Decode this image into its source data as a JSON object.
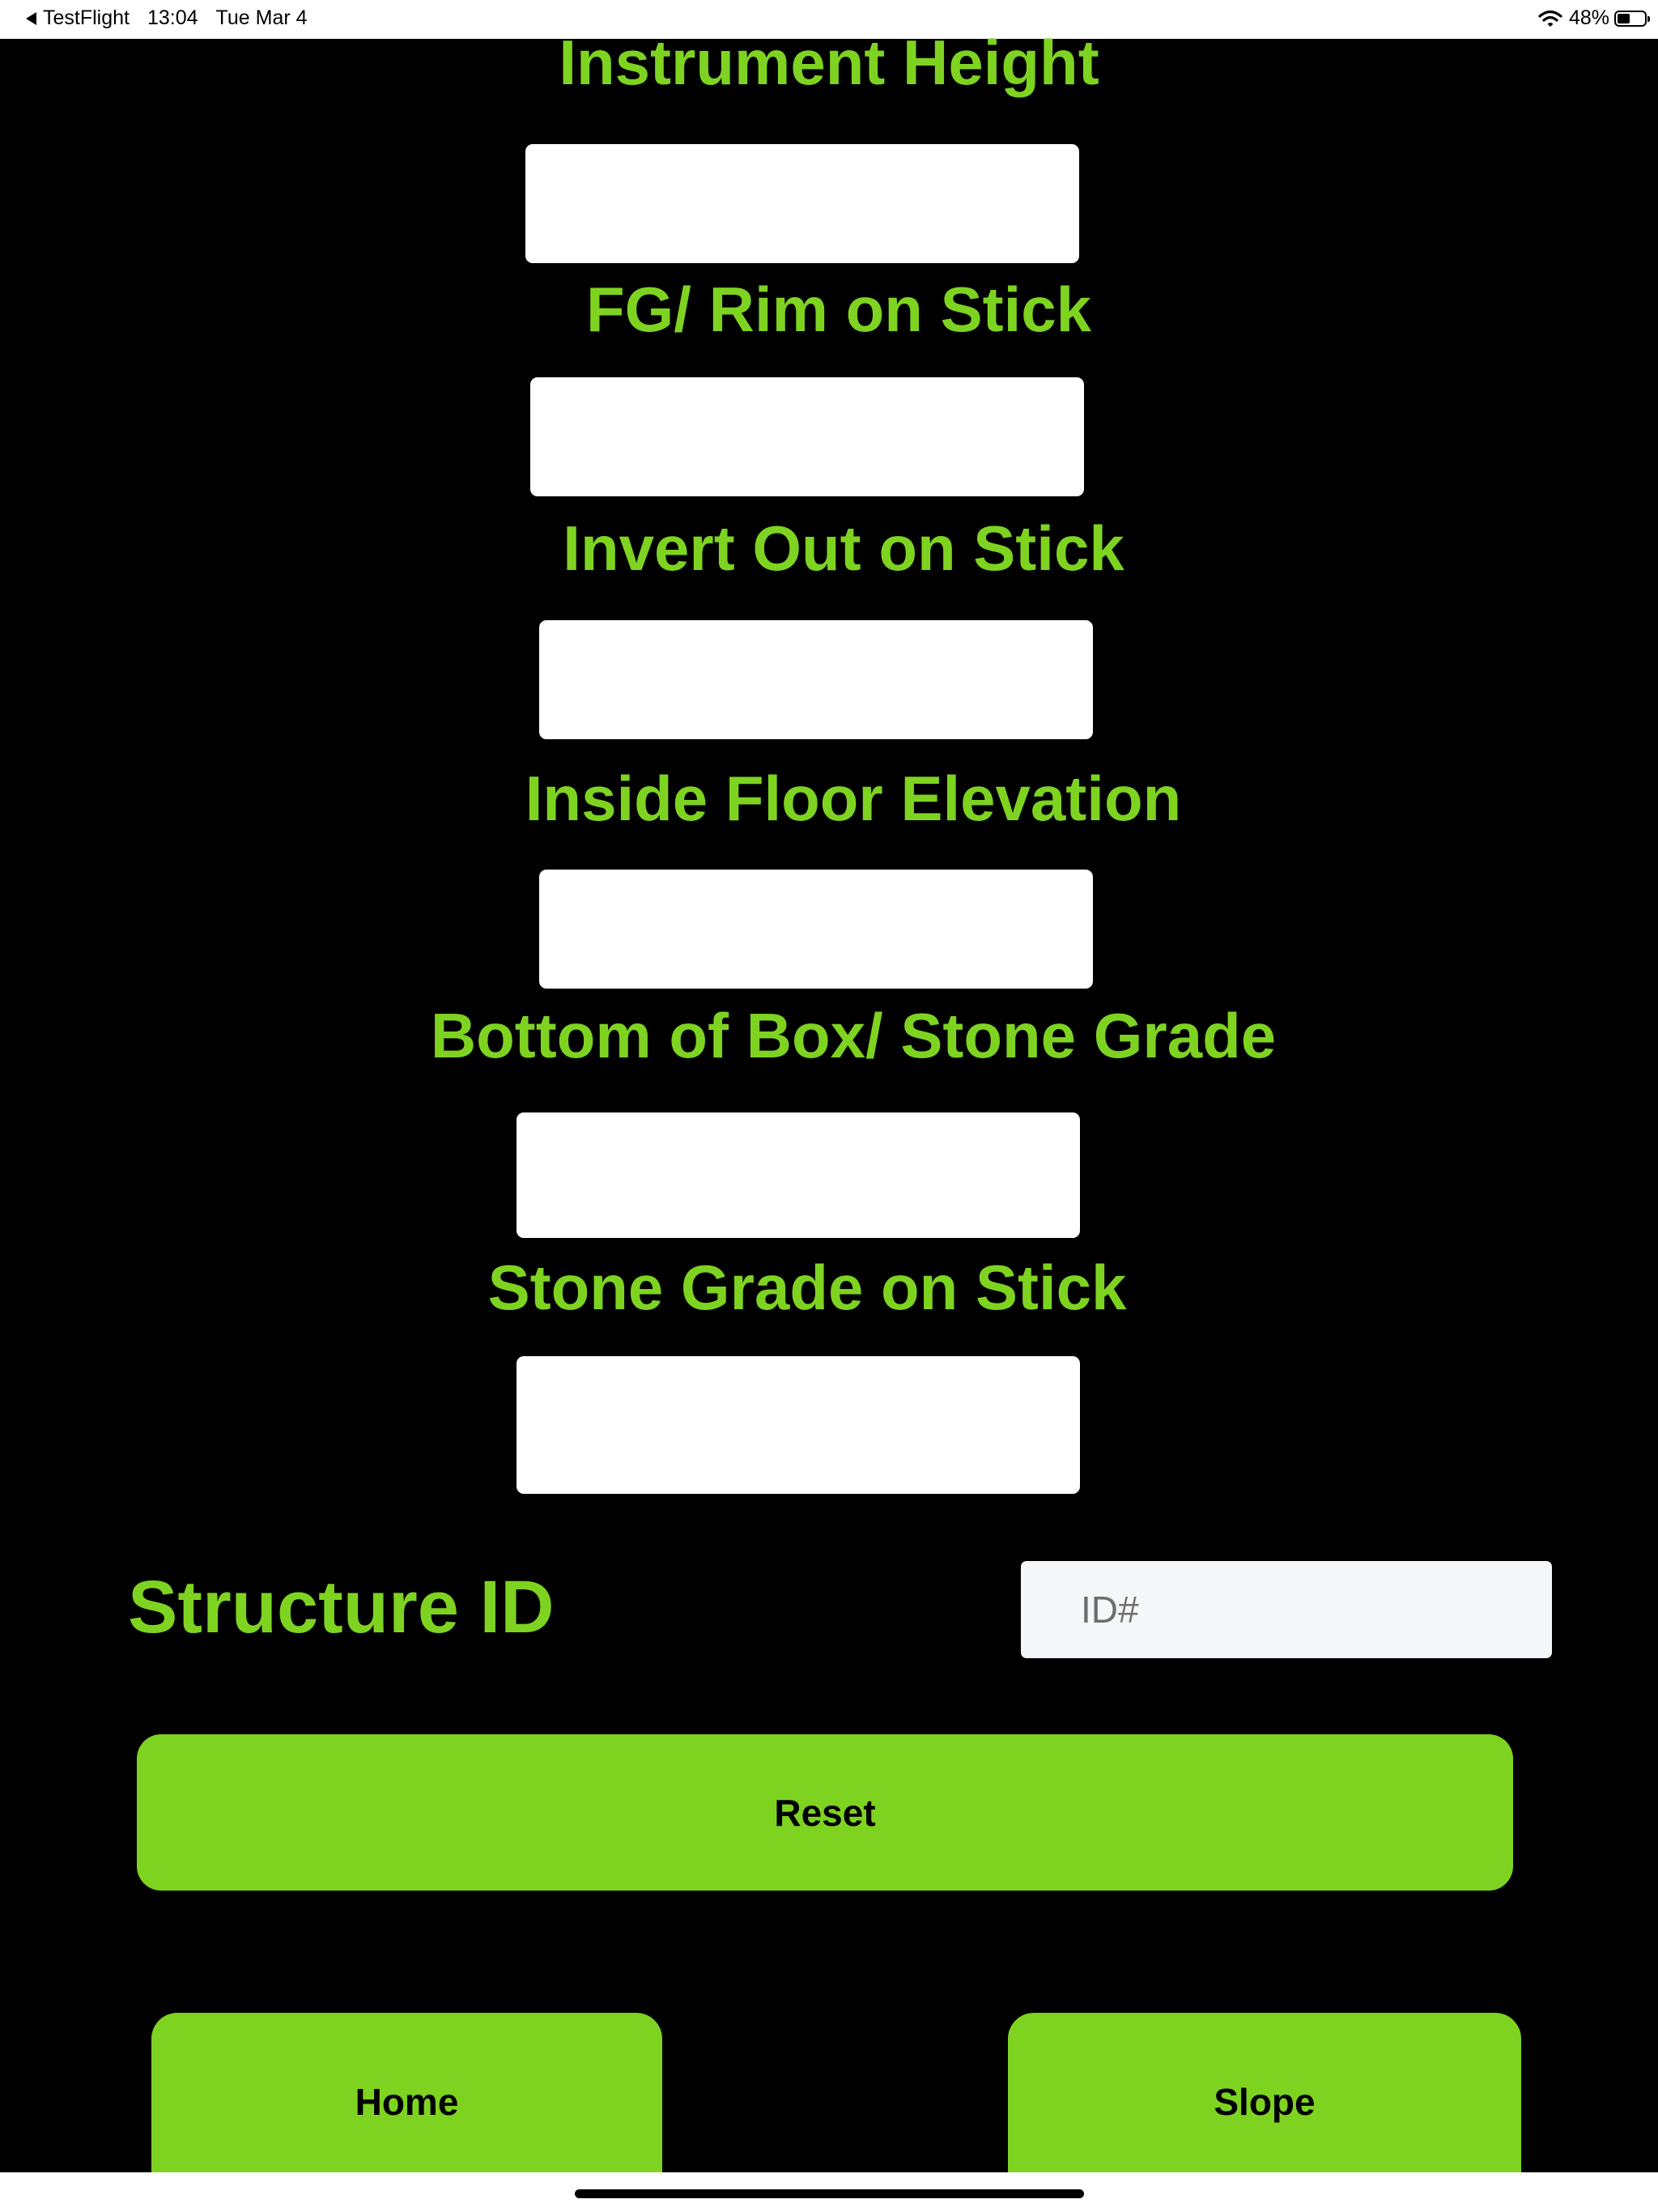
{
  "status_bar": {
    "back_app": "TestFlight",
    "time": "13:04",
    "date": "Tue Mar 4",
    "battery_percent": "48%",
    "battery_level": 0.48
  },
  "fields": [
    {
      "label": "Instrument Height",
      "value": ""
    },
    {
      "label": "FG/ Rim on Stick",
      "value": ""
    },
    {
      "label": "Invert Out on Stick",
      "value": ""
    },
    {
      "label": "Inside Floor Elevation",
      "value": ""
    },
    {
      "label": "Bottom of Box/ Stone Grade",
      "value": ""
    },
    {
      "label": "Stone Grade on Stick",
      "value": ""
    }
  ],
  "structure": {
    "label": "Structure ID",
    "placeholder": "ID#",
    "value": ""
  },
  "buttons": {
    "reset": "Reset",
    "home": "Home",
    "slope": "Slope"
  },
  "colors": {
    "accent": "#7ed321",
    "background": "#000000",
    "field_bg": "#ffffff",
    "id_field_bg": "#f6f7f9"
  },
  "icons": {
    "back": "back-arrow-icon",
    "wifi": "wifi-icon",
    "battery": "battery-icon"
  }
}
